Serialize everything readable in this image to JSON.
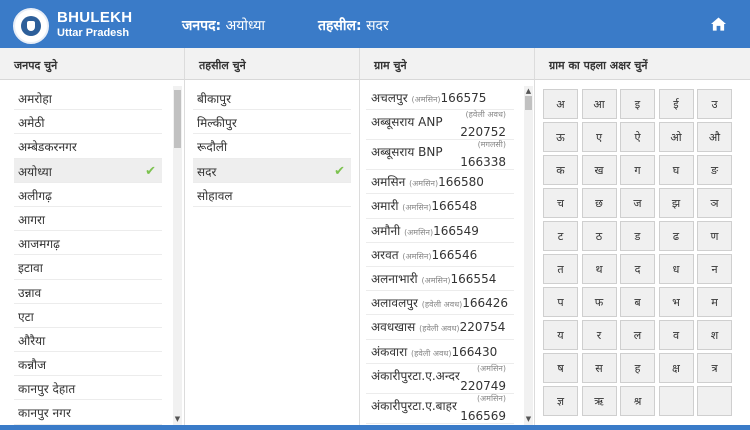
{
  "header": {
    "brand_title": "BHULEKH",
    "brand_subtitle": "Uttar Pradesh",
    "district_label": "जनपद:",
    "district_value": "अयोध्या",
    "tehsil_label": "तहसील:",
    "tehsil_value": "सदर",
    "home_icon": "home-icon"
  },
  "columns": {
    "district_header": "जनपद चुने",
    "tehsil_header": "तहसील चुने",
    "village_header": "ग्राम चुने",
    "letter_header": "ग्राम का पहला अक्षर चुनें"
  },
  "districts": [
    {
      "label": "अमरोहा",
      "selected": false
    },
    {
      "label": "अमेठी",
      "selected": false
    },
    {
      "label": "अम्बेडकरनगर",
      "selected": false
    },
    {
      "label": "अयोध्या",
      "selected": true
    },
    {
      "label": "अलीगढ़",
      "selected": false
    },
    {
      "label": "आगरा",
      "selected": false
    },
    {
      "label": "आजमगढ़",
      "selected": false
    },
    {
      "label": "इटावा",
      "selected": false
    },
    {
      "label": "उन्नाव",
      "selected": false
    },
    {
      "label": "एटा",
      "selected": false
    },
    {
      "label": "औरैया",
      "selected": false
    },
    {
      "label": "कन्नौज",
      "selected": false
    },
    {
      "label": "कानपुर देहात",
      "selected": false
    },
    {
      "label": "कानपुर नगर",
      "selected": false
    }
  ],
  "tehsils": [
    {
      "label": "बीकापुर",
      "selected": false
    },
    {
      "label": "मिल्कीपुर",
      "selected": false
    },
    {
      "label": "रूदौली",
      "selected": false
    },
    {
      "label": "सदर",
      "selected": true
    },
    {
      "label": "सोहावल",
      "selected": false
    }
  ],
  "villages": [
    {
      "name": "अचलपुर",
      "tag": "(अमसिन)",
      "code": "166575",
      "wrap": false
    },
    {
      "name": "अब्बूसराय ANP",
      "tag": "(हवेली अवध)",
      "code": "220752",
      "wrap": true
    },
    {
      "name": "अब्बूसराय BNP",
      "tag": "(मगलसी)",
      "code": "166338",
      "wrap": true
    },
    {
      "name": "अमसिन",
      "tag": "(अमसिन)",
      "code": "166580",
      "wrap": false
    },
    {
      "name": "अमारी",
      "tag": "(अमसिन)",
      "code": "166548",
      "wrap": false
    },
    {
      "name": "अमौनी",
      "tag": "(अमसिन)",
      "code": "166549",
      "wrap": false
    },
    {
      "name": "अरवत",
      "tag": "(अमसिन)",
      "code": "166546",
      "wrap": false
    },
    {
      "name": "अलनाभारी",
      "tag": "(अमसिन)",
      "code": "166554",
      "wrap": false
    },
    {
      "name": "अलावलपुर",
      "tag": "(हवेली अवध)",
      "code": "166426",
      "wrap": false
    },
    {
      "name": "अवधखास",
      "tag": "(हवेली अवध)",
      "code": "220754",
      "wrap": false
    },
    {
      "name": "अंकवारा",
      "tag": "(हवेली अवध)",
      "code": "166430",
      "wrap": false
    },
    {
      "name": "अंकारीपुरटा.ए.अन्दर",
      "tag": "(अमसिन)",
      "code": "220749",
      "wrap": true
    },
    {
      "name": "अंकारीपुरटा.ए.बाहर",
      "tag": "(अमसिन)",
      "code": "166569",
      "wrap": true
    }
  ],
  "letters": [
    "अ",
    "आ",
    "इ",
    "ई",
    "उ",
    "ऊ",
    "ए",
    "ऐ",
    "ओ",
    "औ",
    "क",
    "ख",
    "ग",
    "घ",
    "ङ",
    "च",
    "छ",
    "ज",
    "झ",
    "ञ",
    "ट",
    "ठ",
    "ड",
    "ढ",
    "ण",
    "त",
    "थ",
    "द",
    "ध",
    "न",
    "प",
    "फ",
    "ब",
    "भ",
    "म",
    "य",
    "र",
    "ल",
    "व",
    "श",
    "ष",
    "स",
    "ह",
    "क्ष",
    "त्र",
    "ज्ञ",
    "ऋ",
    "श्र",
    "",
    ""
  ],
  "colors": {
    "header_bg": "#3a7bc8",
    "check_green": "#7cc24f"
  }
}
